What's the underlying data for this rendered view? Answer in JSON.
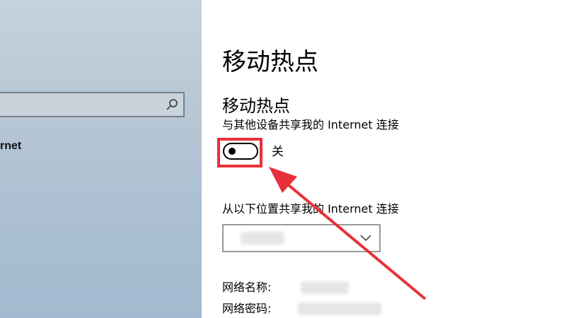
{
  "sidebar": {
    "search": {
      "placeholder": ""
    },
    "nav_item_label": "rnet"
  },
  "main": {
    "page_title": "移动热点",
    "section_title": "移动热点",
    "section_desc": "与其他设备共享我的 Internet 连接",
    "toggle": {
      "state_label": "关",
      "on": false
    },
    "share_from_label": "从以下位置共享我的 Internet 连接",
    "network_name_label": "网络名称:",
    "network_password_label": "网络密码:"
  },
  "colors": {
    "annotation_red": "#e8303a"
  }
}
